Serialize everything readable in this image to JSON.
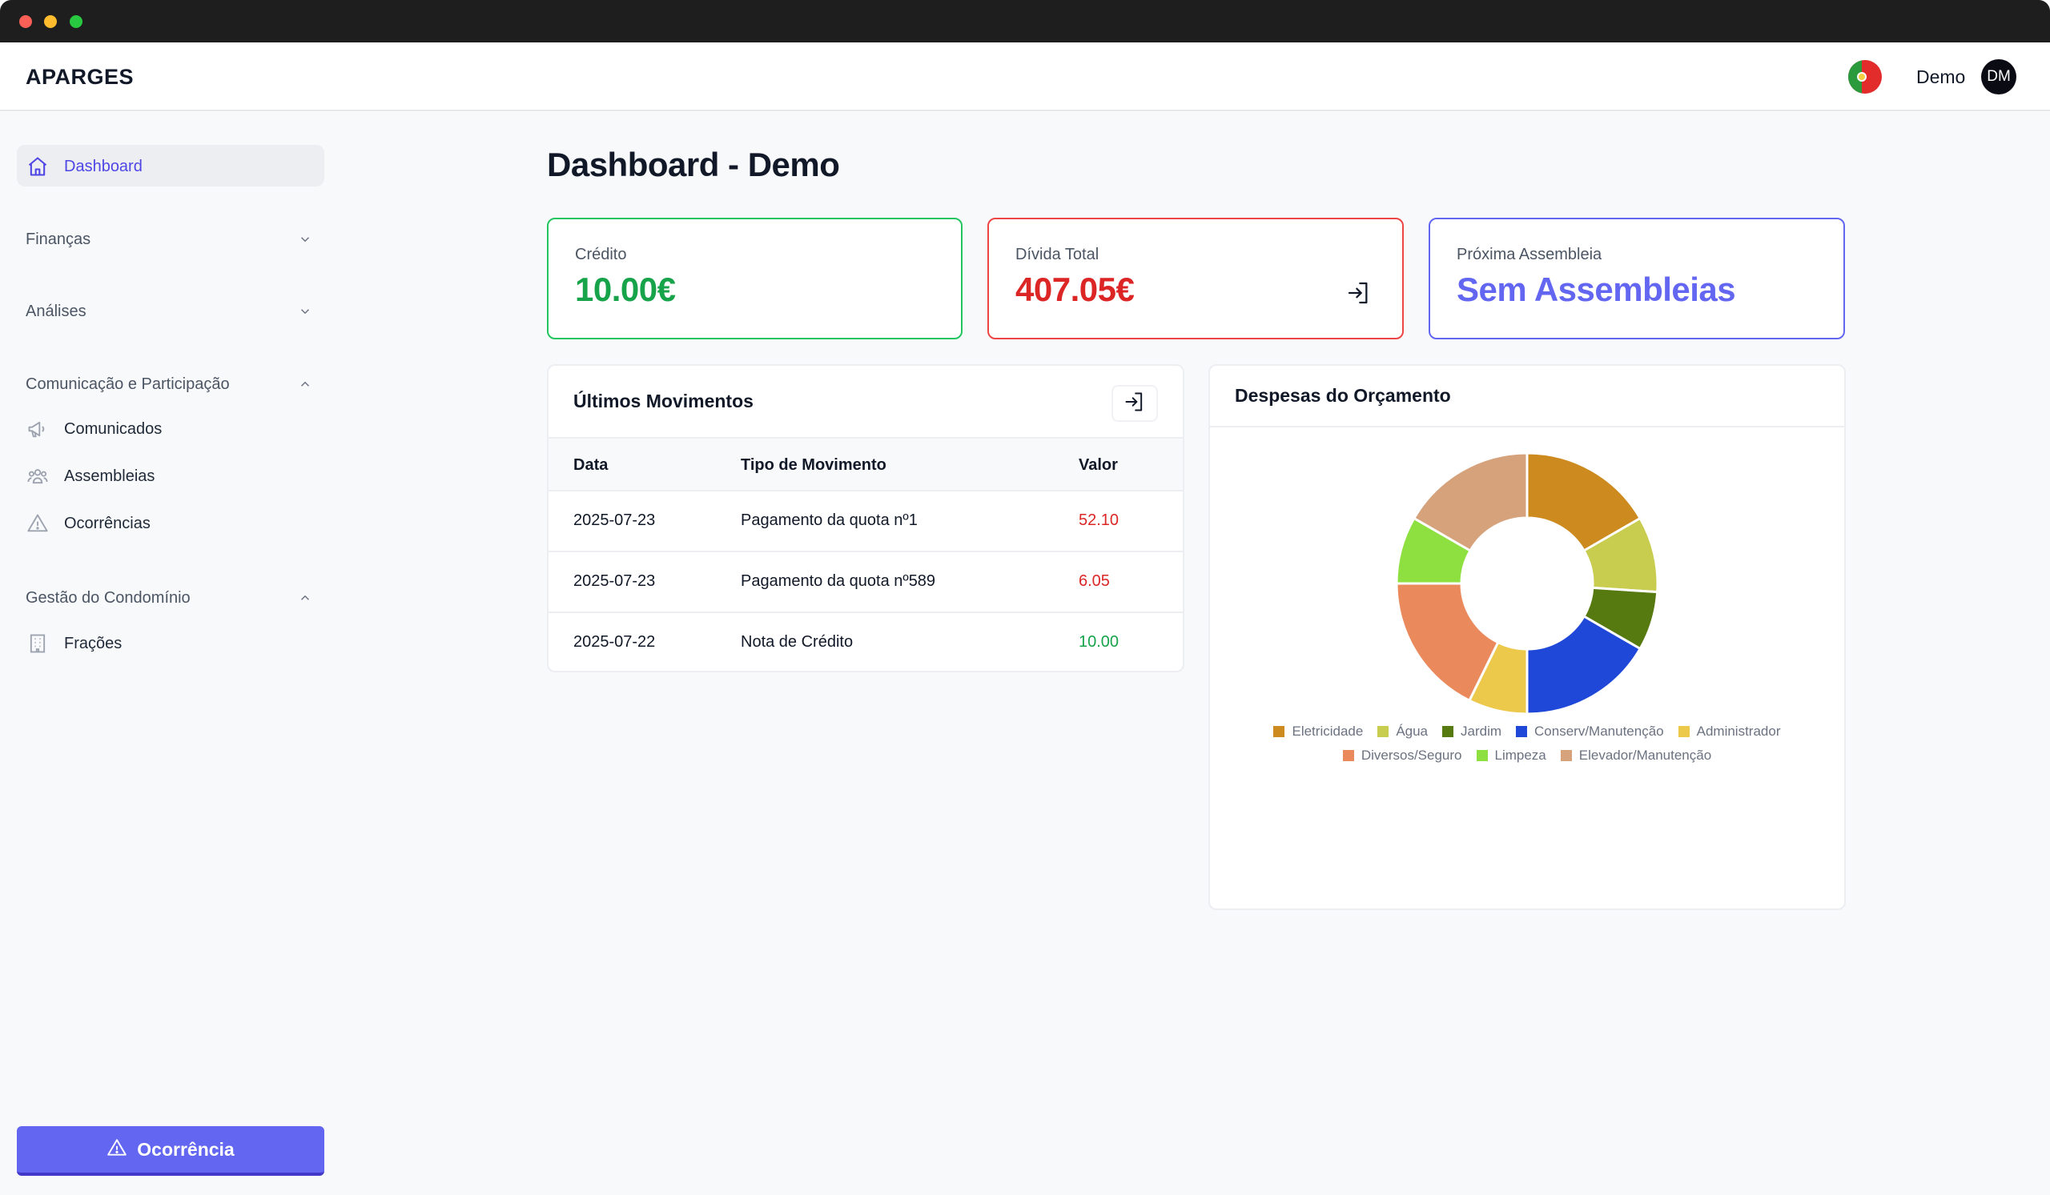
{
  "app": {
    "brand": "APARGES"
  },
  "header": {
    "user_name": "Demo",
    "avatar_initials": "DM",
    "language_flag": "flag-portugal-icon"
  },
  "sidebar": {
    "dashboard": "Dashboard",
    "sections": [
      {
        "label": "Finanças",
        "expanded": false
      },
      {
        "label": "Análises",
        "expanded": false
      },
      {
        "label": "Comunicação e Participação",
        "expanded": true,
        "items": [
          "Comunicados",
          "Assembleias",
          "Ocorrências"
        ]
      },
      {
        "label": "Gestão do Condomínio",
        "expanded": true,
        "items": [
          "Frações"
        ]
      }
    ],
    "report_button": "Ocorrência"
  },
  "page": {
    "title": "Dashboard - Demo"
  },
  "stats": {
    "credit": {
      "label": "Crédito",
      "value": "10.00€"
    },
    "debt": {
      "label": "Dívida Total",
      "value": "407.05€"
    },
    "assembly": {
      "label": "Próxima Assembleia",
      "value": "Sem Assembleias"
    }
  },
  "movements": {
    "title": "Últimos Movimentos",
    "columns": [
      "Data",
      "Tipo de Movimento",
      "Valor"
    ],
    "rows": [
      {
        "date": "2025-07-23",
        "type": "Pagamento da quota nº1",
        "value": "52.10",
        "sign": "neg"
      },
      {
        "date": "2025-07-23",
        "type": "Pagamento da quota nº589",
        "value": "6.05",
        "sign": "neg"
      },
      {
        "date": "2025-07-22",
        "type": "Nota de Crédito",
        "value": "10.00",
        "sign": "pos"
      }
    ]
  },
  "colors": {
    "accent": "#6366f1",
    "positive": "#16a34a",
    "negative": "#dc2626"
  },
  "chart_data": {
    "type": "pie",
    "title": "Despesas do Orçamento",
    "legend_position": "bottom",
    "categories": [
      "Eletricidade",
      "Água",
      "Jardim",
      "Conserv/Manutenção",
      "Administrador",
      "Diversos/Seguro",
      "Limpeza",
      "Elevador/Manutenção"
    ],
    "values": [
      16,
      9,
      7,
      16,
      7,
      17,
      8,
      16
    ],
    "colors": [
      "#cc8a1f",
      "#c8cc4f",
      "#567a10",
      "#1f47d8",
      "#ecc94b",
      "#ea8a5c",
      "#8ee040",
      "#d6a27b"
    ]
  }
}
